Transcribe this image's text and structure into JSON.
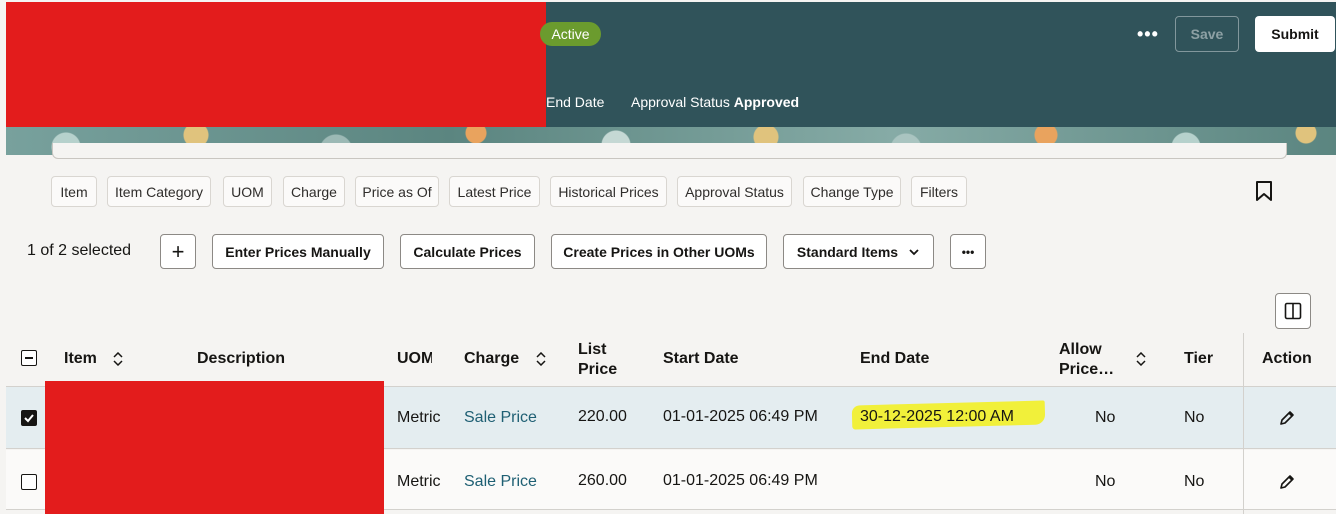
{
  "header": {
    "status": "Active",
    "more_label": "•••",
    "save_label": "Save",
    "submit_label": "Submit",
    "end_date_label": "End Date",
    "approval_label": "Approval Status",
    "approval_value": "Approved"
  },
  "filters": [
    "Item",
    "Item Category",
    "UOM",
    "Charge",
    "Price as Of",
    "Latest Price",
    "Historical Prices",
    "Approval Status",
    "Change Type",
    "Filters"
  ],
  "toolbar": {
    "selected_count": "1 of 2 selected",
    "add_label": "+",
    "enter_prices": "Enter Prices Manually",
    "calculate_prices": "Calculate Prices",
    "create_prices": "Create Prices in Other UOMs",
    "standard_items": "Standard Items",
    "more_label": "•••"
  },
  "table": {
    "columns": {
      "item": "Item",
      "description": "Description",
      "uom": "UOM",
      "charge": "Charge",
      "list_price_1": "List",
      "list_price_2": "Price",
      "start_date": "Start Date",
      "end_date": "End Date",
      "allow_price_1": "Allow",
      "allow_price_2": "Price…",
      "tier": "Tier",
      "action": "Action"
    },
    "rows": [
      {
        "selected": true,
        "uom": "Metric",
        "charge": "Sale Price",
        "list_price": "220.00",
        "start_date": "01-01-2025 06:49 PM",
        "end_date": "30-12-2025 12:00 AM",
        "allow_price": "No",
        "tier": "No"
      },
      {
        "selected": false,
        "uom": "Metric",
        "charge": "Sale Price",
        "list_price": "260.00",
        "start_date": "01-01-2025 06:49 PM",
        "end_date": "",
        "allow_price": "No",
        "tier": "No"
      }
    ]
  },
  "icons": {
    "bookmark": "bookmark-icon",
    "columns": "column-layout-icon",
    "edit": "pencil-icon",
    "sort": "sort-icon",
    "chevron": "chevron-down-icon"
  },
  "colors": {
    "header_bg": "#30535a",
    "status_green": "#6b9b2e",
    "link": "#1e5f73",
    "selected_row": "#e4edf0",
    "highlight": "#f1f03a",
    "redaction": "#e31c1c"
  }
}
